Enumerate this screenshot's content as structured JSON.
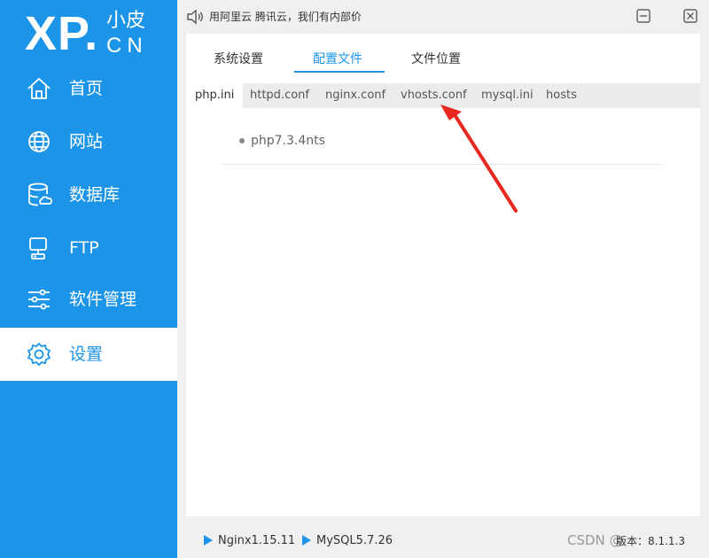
{
  "logo": {
    "big": "XP.",
    "cn": "小皮",
    "en": "CN"
  },
  "sidebar": {
    "items": [
      {
        "label": "首页",
        "icon": "home-icon"
      },
      {
        "label": "网站",
        "icon": "globe-icon"
      },
      {
        "label": "数据库",
        "icon": "database-icon"
      },
      {
        "label": "FTP",
        "icon": "server-icon"
      },
      {
        "label": "软件管理",
        "icon": "sliders-icon"
      },
      {
        "label": "设置",
        "icon": "gear-icon",
        "active": true
      }
    ]
  },
  "titlebar": {
    "notice": "用阿里云 腾讯云，我们有内部价",
    "speaker_icon": "speaker-icon",
    "minimize_icon": "minimize-icon",
    "close_icon": "close-icon"
  },
  "tabs": [
    {
      "label": "系统设置"
    },
    {
      "label": "配置文件",
      "active": true
    },
    {
      "label": "文件位置"
    }
  ],
  "subtabs": [
    {
      "label": "php.ini",
      "active": true
    },
    {
      "label": "httpd.conf"
    },
    {
      "label": "nginx.conf"
    },
    {
      "label": "vhosts.conf"
    },
    {
      "label": "mysql.ini"
    },
    {
      "label": "hosts"
    }
  ],
  "list": [
    {
      "label": "php7.3.4nts"
    }
  ],
  "status": {
    "services": [
      {
        "label": "Nginx1.15.11"
      },
      {
        "label": "MySQL5.7.26"
      }
    ],
    "watermark": "CSDN @",
    "version": "版本：8.1.1.3"
  },
  "colors": {
    "accent": "#1c95e8",
    "arrow": "#e8281e"
  }
}
